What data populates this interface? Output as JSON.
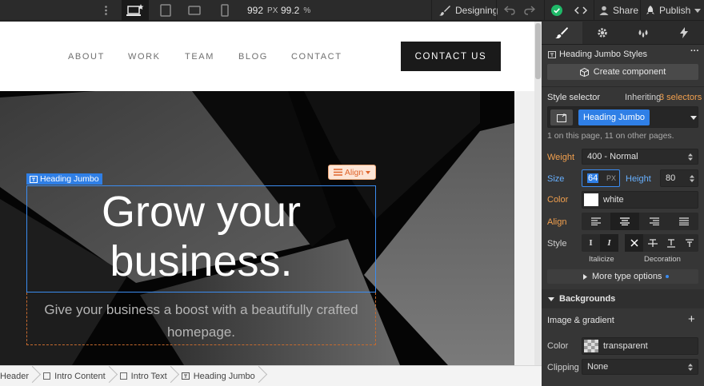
{
  "topbar": {
    "width_value": "992",
    "width_unit": "PX",
    "zoom_value": "99.2",
    "zoom_unit": "%",
    "mode_label": "Designing",
    "share_label": "Share",
    "publish_label": "Publish"
  },
  "nav": {
    "links": [
      "ABOUT",
      "WORK",
      "TEAM",
      "BLOG",
      "CONTACT"
    ],
    "cta": "CONTACT US"
  },
  "hero": {
    "tag_label": "Heading Jumbo",
    "align_label": "Align",
    "heading": "Grow your business.",
    "subheading": "Give your business a boost with a beautifully crafted homepage."
  },
  "breadcrumbs": [
    "Header",
    "Intro Content",
    "Intro Text",
    "Heading Jumbo"
  ],
  "panel": {
    "header_title": "Heading Jumbo Styles",
    "create_component": "Create component",
    "style_selector_label": "Style selector",
    "inheriting_label": "Inheriting",
    "inheriting_count": "3 selectors",
    "selector_chip": "Heading Jumbo",
    "usage_note": "1 on this page, 11 on other pages.",
    "weight_label": "Weight",
    "weight_value": "400 - Normal",
    "size_label": "Size",
    "size_value": "64",
    "size_unit": "PX",
    "height_label": "Height",
    "height_value": "80",
    "color_label": "Color",
    "color_value": "white",
    "align_label": "Align",
    "style_label": "Style",
    "italicize_label": "Italicize",
    "decoration_label": "Decoration",
    "more_type": "More type options",
    "backgrounds_title": "Backgrounds",
    "image_gradient": "Image & gradient",
    "bg_color_label": "Color",
    "bg_color_value": "transparent",
    "clipping_label": "Clipping",
    "clipping_value": "None"
  },
  "colors": {
    "accent_blue": "#2f7fe6",
    "accent_orange": "#f2a04e",
    "status_green": "#1fb868"
  }
}
